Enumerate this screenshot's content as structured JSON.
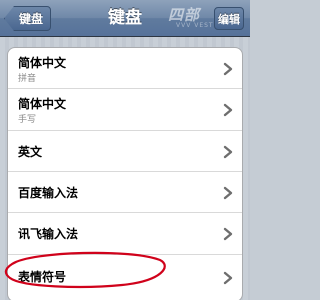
{
  "navbar": {
    "back_label": "键盘",
    "title": "键盘",
    "edit_label": "编辑",
    "watermark": "四部",
    "watermark_sub": "VVV VEST"
  },
  "keyboards": [
    {
      "title": "简体中文",
      "subtitle": "拼音"
    },
    {
      "title": "简体中文",
      "subtitle": "手写"
    },
    {
      "title": "英文"
    },
    {
      "title": "百度输入法"
    },
    {
      "title": "讯飞输入法"
    },
    {
      "title": "表情符号"
    }
  ],
  "colors": {
    "annotation": "#d0021b",
    "chevron": "#6e6e6e"
  }
}
